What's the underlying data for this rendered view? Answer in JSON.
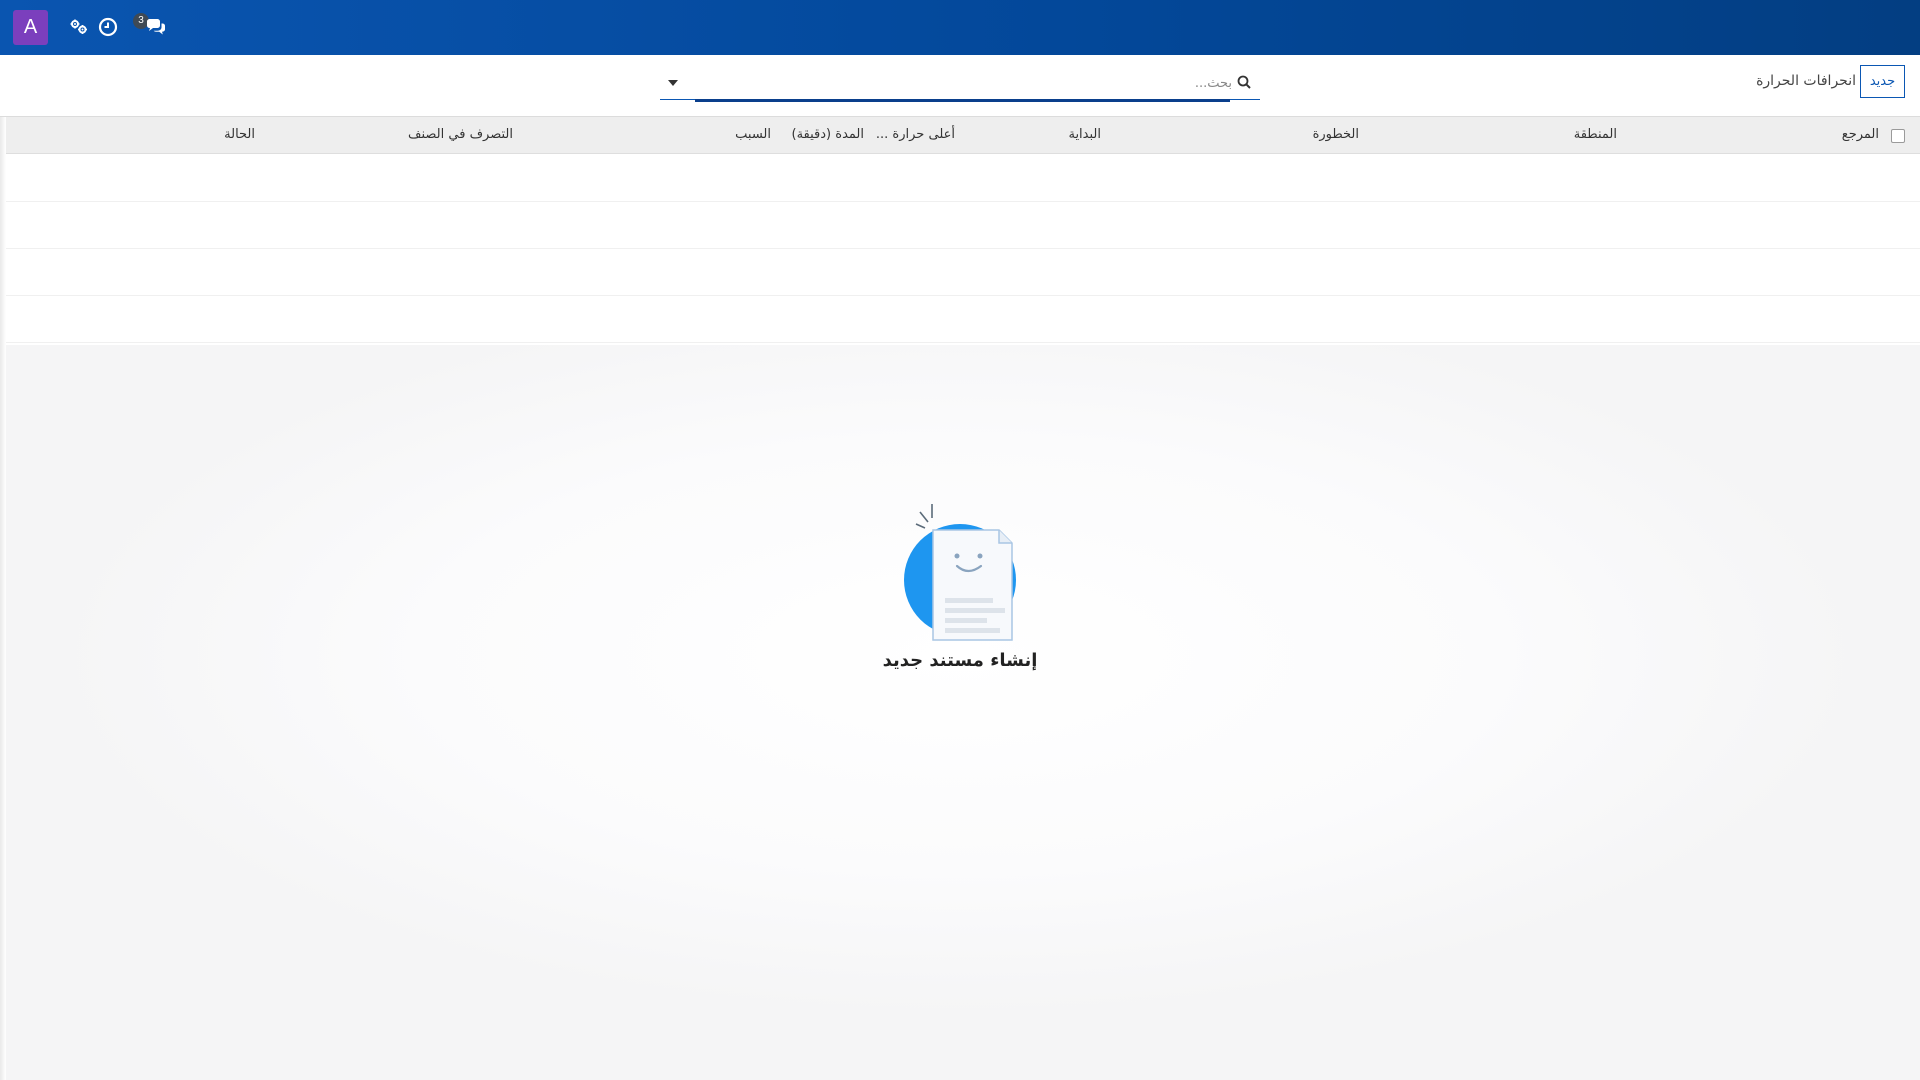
{
  "navbar": {
    "avatar_letter": "A",
    "chat_badge_count": "3",
    "icons": [
      "users-gear-icon",
      "clock-icon",
      "chat-icon"
    ],
    "accent_color": "#0a55b0"
  },
  "control_panel": {
    "new_button_label": "جديد",
    "breadcrumb": "انحرافات الحرارة",
    "search_placeholder": "بحث..."
  },
  "list": {
    "columns": [
      "المرجع",
      "المنطقة",
      "الخطورة",
      "البداية",
      "أعلى حرارة ...",
      "المدة (دقيقة)",
      "السبب",
      "التصرف في الصنف",
      "الحالة"
    ],
    "rows": []
  },
  "help": {
    "title": "إنشاء مستند جديد"
  }
}
